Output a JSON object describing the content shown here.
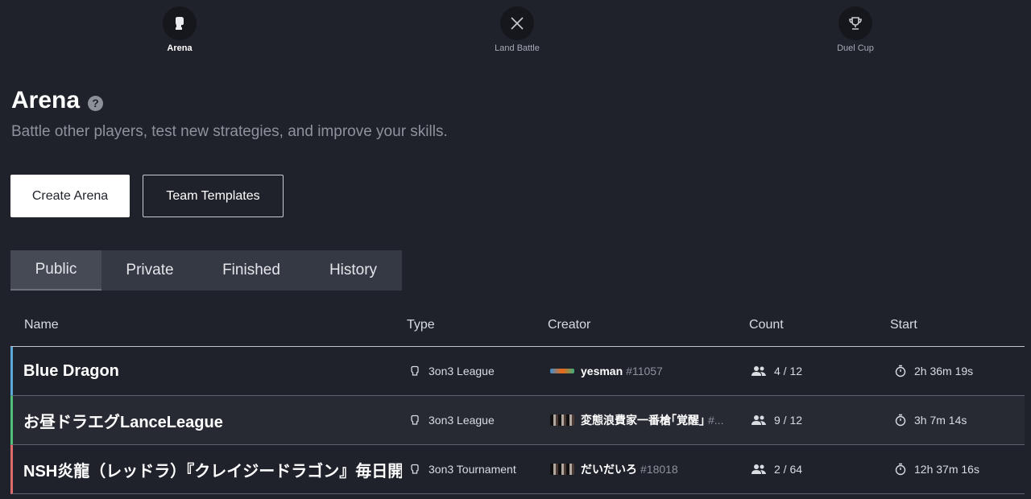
{
  "nav": {
    "items": [
      {
        "label": "Arena",
        "icon": "boxing-glove-icon",
        "active": true
      },
      {
        "label": "Land Battle",
        "icon": "crossed-swords-icon",
        "active": false
      },
      {
        "label": "Duel Cup",
        "icon": "trophy-icon",
        "active": false
      }
    ]
  },
  "page": {
    "title": "Arena",
    "help_icon": "?",
    "subtitle": "Battle other players, test new strategies, and improve your skills."
  },
  "buttons": {
    "create": "Create Arena",
    "templates": "Team Templates"
  },
  "tabs": [
    "Public",
    "Private",
    "Finished",
    "History"
  ],
  "table": {
    "headers": {
      "name": "Name",
      "type": "Type",
      "creator": "Creator",
      "count": "Count",
      "start": "Start"
    },
    "rows": [
      {
        "name": "Blue Dragon",
        "type": "3on3 League",
        "creator": "yesman",
        "creator_tag": "#11057",
        "count": "4 / 12",
        "start": "2h 36m 19s",
        "accent": "#5ba8d6"
      },
      {
        "name": "お昼ドラエグLanceLeague",
        "type": "3on3 League",
        "creator": "変態浪費家一番槍｢覚醒｣",
        "creator_tag": "#...",
        "count": "9 / 12",
        "start": "3h 7m 14s",
        "accent": "#4fbf7a"
      },
      {
        "name": "NSH炎龍（レッドラ）『クレイジードラゴン』毎日開催",
        "type": "3on3 Tournament",
        "creator": "だいだいろ",
        "creator_tag": "#18018",
        "count": "2 / 64",
        "start": "12h 37m 16s",
        "accent": "#e06b6b"
      }
    ]
  }
}
